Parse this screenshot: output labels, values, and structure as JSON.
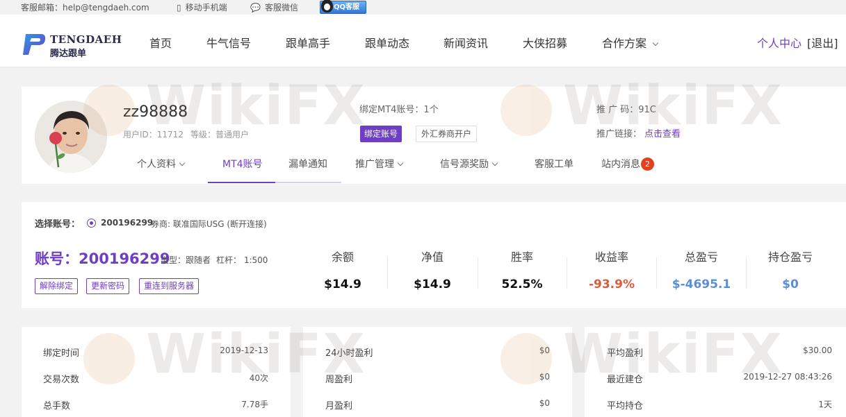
{
  "topbar": {
    "email": "客服邮箱：help@tengdaeh.com",
    "mobile": "移动手机端",
    "wechat": "客服微信",
    "qq": "QQ客服"
  },
  "logo": {
    "en": "TENGDAEH",
    "cn": "腾达跟单"
  },
  "nav": {
    "items": [
      "首页",
      "牛气信号",
      "跟单高手",
      "跟单动态",
      "新闻资讯",
      "大侠招募",
      "合作方案"
    ],
    "personal_center": "个人中心",
    "logout": "[退出]"
  },
  "profile": {
    "username": "zz98888",
    "user_id": "用户ID：11712",
    "level": "等级：普通用户",
    "bound_mt4": "绑定MT4账号：1个",
    "bind_button": "绑定账号",
    "open_button": "外汇券商开户",
    "promo_code": "推 广 码：91C",
    "promo_link_label": "推广链接：",
    "promo_link_text": "点击查看",
    "tabs": [
      "个人资料",
      "MT4账号",
      "漏单通知",
      "推广管理",
      "信号源奖励",
      "客服工单",
      "站内消息"
    ],
    "unread": "2"
  },
  "account": {
    "select_label": "选择账号：",
    "selected_number": "200196299",
    "broker": "券商: 联准国际USG (断开连接)",
    "title": "账号：200196299",
    "type": "类型：跟随者",
    "leverage": "杠杆： 1:500",
    "buttons": [
      "解除绑定",
      "更新密码",
      "重连到服务器"
    ],
    "stats": [
      {
        "label": "余额",
        "value": "$14.9",
        "color": "#111111"
      },
      {
        "label": "净值",
        "value": "$14.9",
        "color": "#111111"
      },
      {
        "label": "胜率",
        "value": "52.5%",
        "color": "#111111"
      },
      {
        "label": "收益率",
        "value": "-93.9%",
        "color": "#e05a3a"
      },
      {
        "label": "总盈亏",
        "value": "$-4695.1",
        "color": "#5a8fd8"
      },
      {
        "label": "持仓盈亏",
        "value": "$0",
        "color": "#5a8fd8"
      }
    ]
  },
  "cards": {
    "left": [
      {
        "k": "绑定时间",
        "v": "2019-12-13"
      },
      {
        "k": "交易次数",
        "v": "40次"
      },
      {
        "k": "总手数",
        "v": "7.78手"
      }
    ],
    "middle": [
      {
        "k": "24小时盈利",
        "v": "$0"
      },
      {
        "k": "周盈利",
        "v": "$0"
      },
      {
        "k": "月盈利",
        "v": "$0"
      }
    ],
    "right": [
      {
        "k": "平均盈利",
        "v": "$30.00"
      },
      {
        "k": "最近建仓",
        "v": "2019-12-27 08:43:26"
      },
      {
        "k": "平均持仓",
        "v": "1天"
      }
    ]
  },
  "watermark": "WikiFX",
  "colors": {
    "accent": "#6e3fc5",
    "negative": "#e05a3a",
    "blue": "#5a8fd8",
    "badge": "#e2401e"
  }
}
